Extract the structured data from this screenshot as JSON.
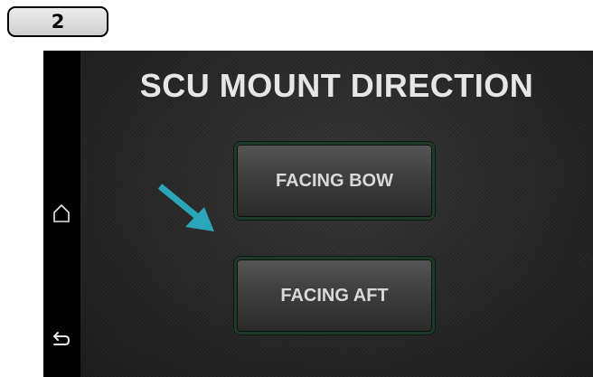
{
  "step_badge": {
    "label": "2"
  },
  "screen": {
    "title": "SCU MOUNT DIRECTION",
    "options": [
      {
        "label": "FACING BOW"
      },
      {
        "label": "FACING AFT"
      }
    ]
  },
  "nav": {
    "home_icon": "home-icon",
    "back_icon": "back-icon"
  },
  "colors": {
    "arrow": "#2aa6b8",
    "button_border": "#1f3a2a",
    "screen_bg": "#2c2c2c",
    "title_text": "#e6e6e6"
  }
}
